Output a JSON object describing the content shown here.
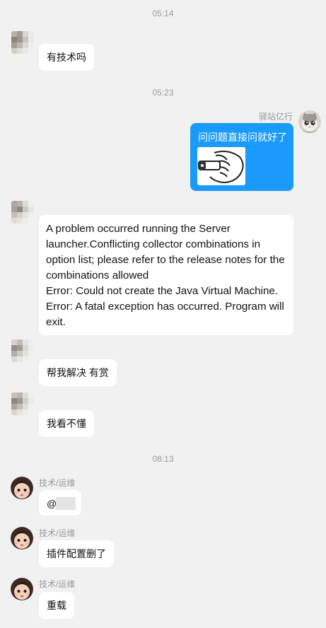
{
  "timestamps": [
    "05:14",
    "05:23",
    "08:13"
  ],
  "messages": [
    {
      "text": "有技术吗"
    },
    {
      "sender": "驿站亿行",
      "text": "问问题直接问就好了"
    },
    {
      "text": "A problem occurred running the Server launcher.Conflicting collector combinations in option list; please refer to the release notes for the combinations allowed\nError: Could not create the Java Virtual Machine.\nError: A fatal exception has occurred. Program will exit."
    },
    {
      "text": "帮我解决 有赏"
    },
    {
      "text": "我看不懂"
    },
    {
      "sender": "技术/运维",
      "text": "@"
    },
    {
      "sender": "技术/运维",
      "text": "插件配置删了"
    },
    {
      "sender": "技术/运维",
      "text": "重载"
    }
  ],
  "colors": {
    "background": "#f1f1f1",
    "bubble_incoming": "#ffffff",
    "bubble_outgoing": "#1a9bfc",
    "meta_text": "#9a9a9a"
  },
  "icons": {
    "sticker": "hand-holding-sticker-icon"
  }
}
